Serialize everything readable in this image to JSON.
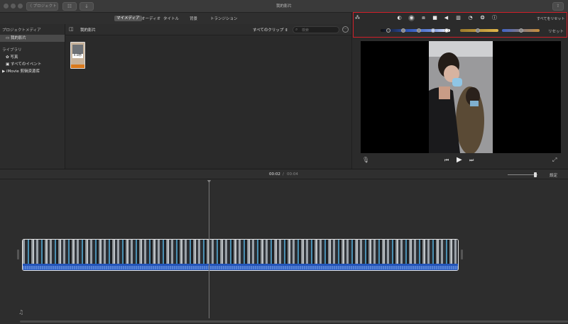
{
  "window": {
    "title": "我的影片",
    "back_label": "〈 プロジェクト",
    "share_icon": "share-icon"
  },
  "media_tabs": [
    {
      "label": "マイメディア",
      "active": true
    },
    {
      "label": "オーディオ"
    },
    {
      "label": "タイトル"
    },
    {
      "label": "背景"
    },
    {
      "label": "トランジション"
    }
  ],
  "sidebar": {
    "project_media_header": "プロジェクトメディア",
    "project_item": "我的影片",
    "library_header": "ライブラリ",
    "library_items": [
      "写真",
      "すべてのイベント"
    ],
    "imovie_library": "iMovie 剪辑资源库"
  },
  "browser": {
    "title": "我的影片",
    "filter_label": "すべてのクリップ ⇕",
    "search_placeholder": "検索",
    "thumb_duration": "4.8秒"
  },
  "viewer": {
    "reset_all": "すべてをリセット",
    "reset": "リセット",
    "tools": [
      "color-balance-icon",
      "color-correction-icon",
      "crop-icon",
      "stabilization-icon",
      "volume-icon",
      "noise-reduction-icon",
      "speed-icon",
      "clip-filter-icon",
      "info-icon"
    ]
  },
  "timeline": {
    "current_time": "00:02",
    "separator": "/",
    "total_time": "00:04",
    "settings_label": "設定",
    "zoom_level": 0.93
  },
  "colors": {
    "highlight_border": "#d2202a",
    "audio_blue": "#2354b8",
    "skin_slider": "#d6a93b",
    "cool_slider": "#3f63c9"
  }
}
